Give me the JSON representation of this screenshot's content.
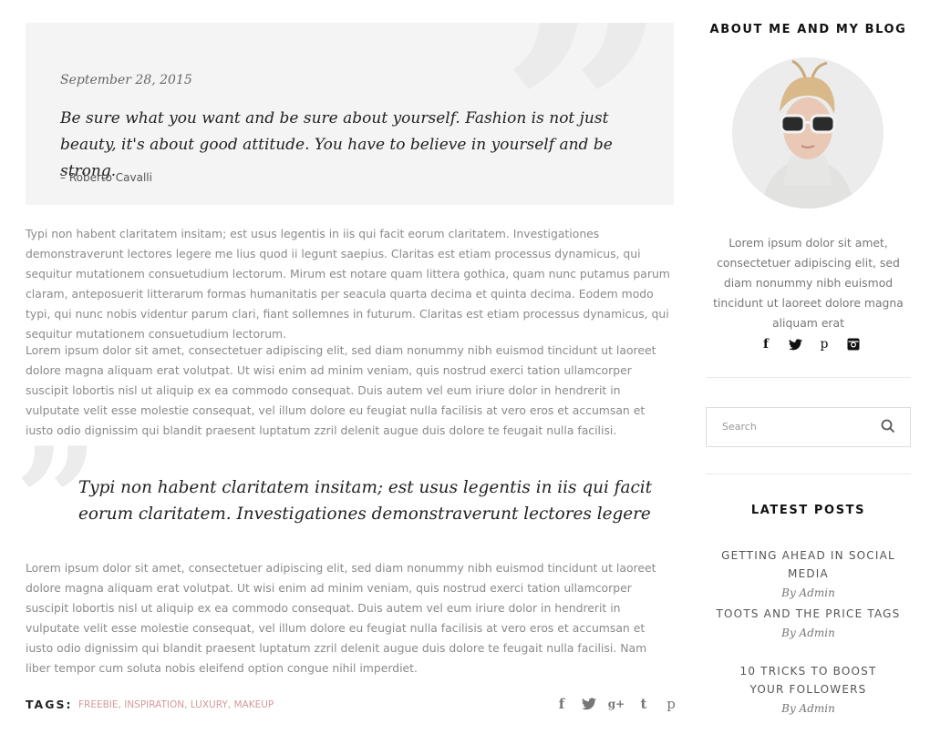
{
  "quote": {
    "date": "September 28, 2015",
    "text": "Be sure what you want and be sure about yourself. Fashion is not just beauty, it's about good attitude. You have to believe in yourself and be strong.",
    "author": "– Roberto Cavalli"
  },
  "body": {
    "p1": "Typi non habent claritatem insitam; est usus legentis in iis qui facit eorum claritatem. Investigationes demonstraverunt lectores legere me lius quod ii legunt saepius. Claritas est etiam processus dynamicus, qui sequitur mutationem consuetudium lectorum. Mirum est notare quam littera gothica, quam nunc putamus parum claram, anteposuerit litterarum formas humanitatis per seacula quarta decima et quinta decima. Eodem modo typi, qui nunc nobis videntur parum clari, fiant sollemnes in futurum. Claritas est etiam processus dynamicus, qui sequitur mutationem consuetudium lectorum.",
    "p2": "Lorem ipsum dolor sit amet, consectetuer adipiscing elit, sed diam nonummy nibh euismod tincidunt ut laoreet dolore magna aliquam erat volutpat. Ut wisi enim ad minim veniam, quis nostrud exerci tation ullamcorper suscipit lobortis nisl ut aliquip ex ea commodo consequat. Duis autem vel eum iriure dolor in hendrerit in vulputate velit esse molestie consequat, vel illum dolore eu feugiat nulla facilisis at vero eros et accumsan et iusto odio dignissim qui blandit praesent luptatum zzril delenit augue duis dolore te feugait nulla facilisi.",
    "pull_quote": "Typi non habent claritatem insitam; est usus legentis in iis qui facit eorum claritatem. Investigationes demonstraverunt lectores legere",
    "p3": "Lorem ipsum dolor sit amet, consectetuer adipiscing elit, sed diam nonummy nibh euismod tincidunt ut laoreet dolore magna aliquam erat volutpat. Ut wisi enim ad minim veniam, quis nostrud exerci tation ullamcorper suscipit lobortis nisl ut aliquip ex ea commodo consequat. Duis autem vel eum iriure dolor in hendrerit in vulputate velit esse molestie consequat, vel illum dolore eu feugiat nulla facilisis at vero eros et accumsan et iusto odio dignissim qui blandit praesent luptatum zzril delenit augue duis dolore te feugait nulla facilisi. Nam liber tempor cum soluta nobis eleifend option congue nihil imperdiet."
  },
  "tags": {
    "label": "TAGS:",
    "items": [
      "FREEBIE",
      "INSPIRATION",
      "LUXURY",
      "MAKEUP"
    ],
    "separator": ", "
  },
  "share_icons": [
    "facebook-icon",
    "twitter-icon",
    "google-plus-icon",
    "tumblr-icon",
    "pinterest-icon"
  ],
  "sidebar": {
    "about_title": "ABOUT ME AND MY BLOG",
    "about_text": "Lorem ipsum dolor sit amet, consectetuer adipiscing elit, sed diam nonummy nibh euismod tincidunt ut laoreet dolore magna aliquam erat",
    "social_icons": [
      "facebook-icon",
      "twitter-icon",
      "pinterest-icon",
      "instagram-icon"
    ],
    "search_placeholder": "Search",
    "latest_title": "LATEST POSTS",
    "posts": [
      {
        "title": "GETTING AHEAD IN SOCIAL MEDIA",
        "byline": "By Admin"
      },
      {
        "title": "TOOTS AND THE PRICE TAGS",
        "byline": "By Admin"
      },
      {
        "title": "10 TRICKS TO BOOST YOUR FOLLOWERS",
        "byline": "By Admin"
      }
    ]
  },
  "colors": {
    "accent": "#d49a9a",
    "quote_bg": "#f4f4f4",
    "text_muted": "#8a8a8a",
    "heading": "#111111"
  }
}
